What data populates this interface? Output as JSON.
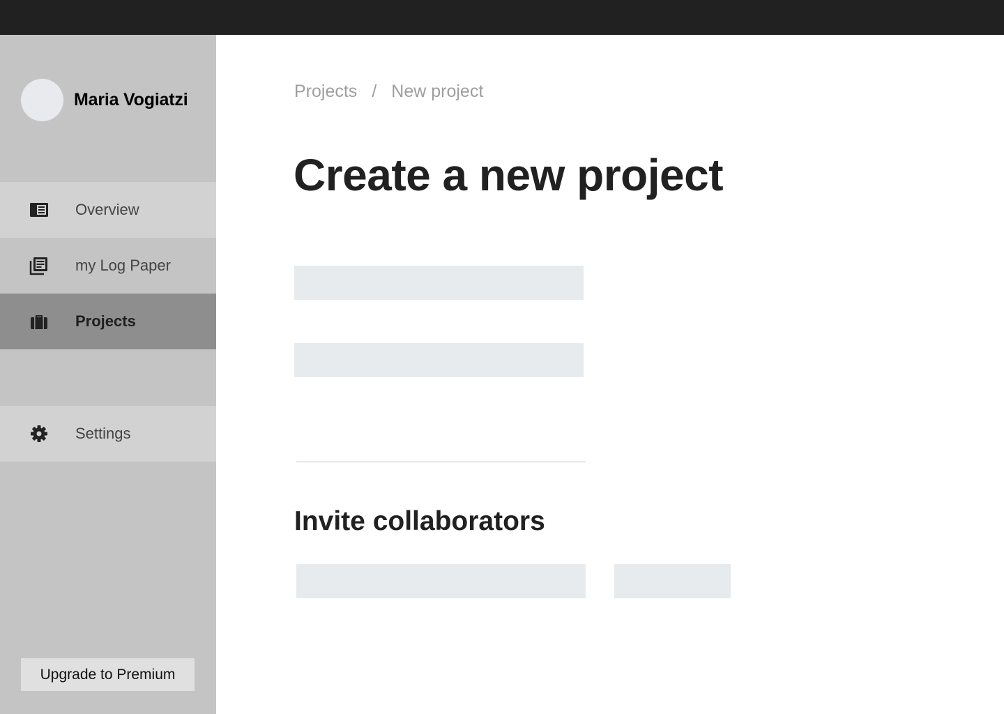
{
  "user": {
    "name": "Maria Vogiatzi"
  },
  "sidebar": {
    "items": [
      {
        "label": "Overview",
        "icon": "newspaper-icon",
        "active": false
      },
      {
        "label": "my Log Paper",
        "icon": "library-books-icon",
        "active": false
      },
      {
        "label": "Projects",
        "icon": "briefcase-icon",
        "active": true
      },
      {
        "label": "Settings",
        "icon": "gear-icon",
        "active": false
      }
    ],
    "upgrade_label": "Upgrade to Premium"
  },
  "breadcrumb": {
    "items": [
      "Projects",
      "New project"
    ],
    "separator": "/"
  },
  "main": {
    "title": "Create a new project",
    "invite_title": "Invite collaborators"
  },
  "colors": {
    "topbar": "#212121",
    "sidebar": "#c4c4c4",
    "sidebar_active": "#8e8e8e",
    "field": "#e8ebee"
  }
}
